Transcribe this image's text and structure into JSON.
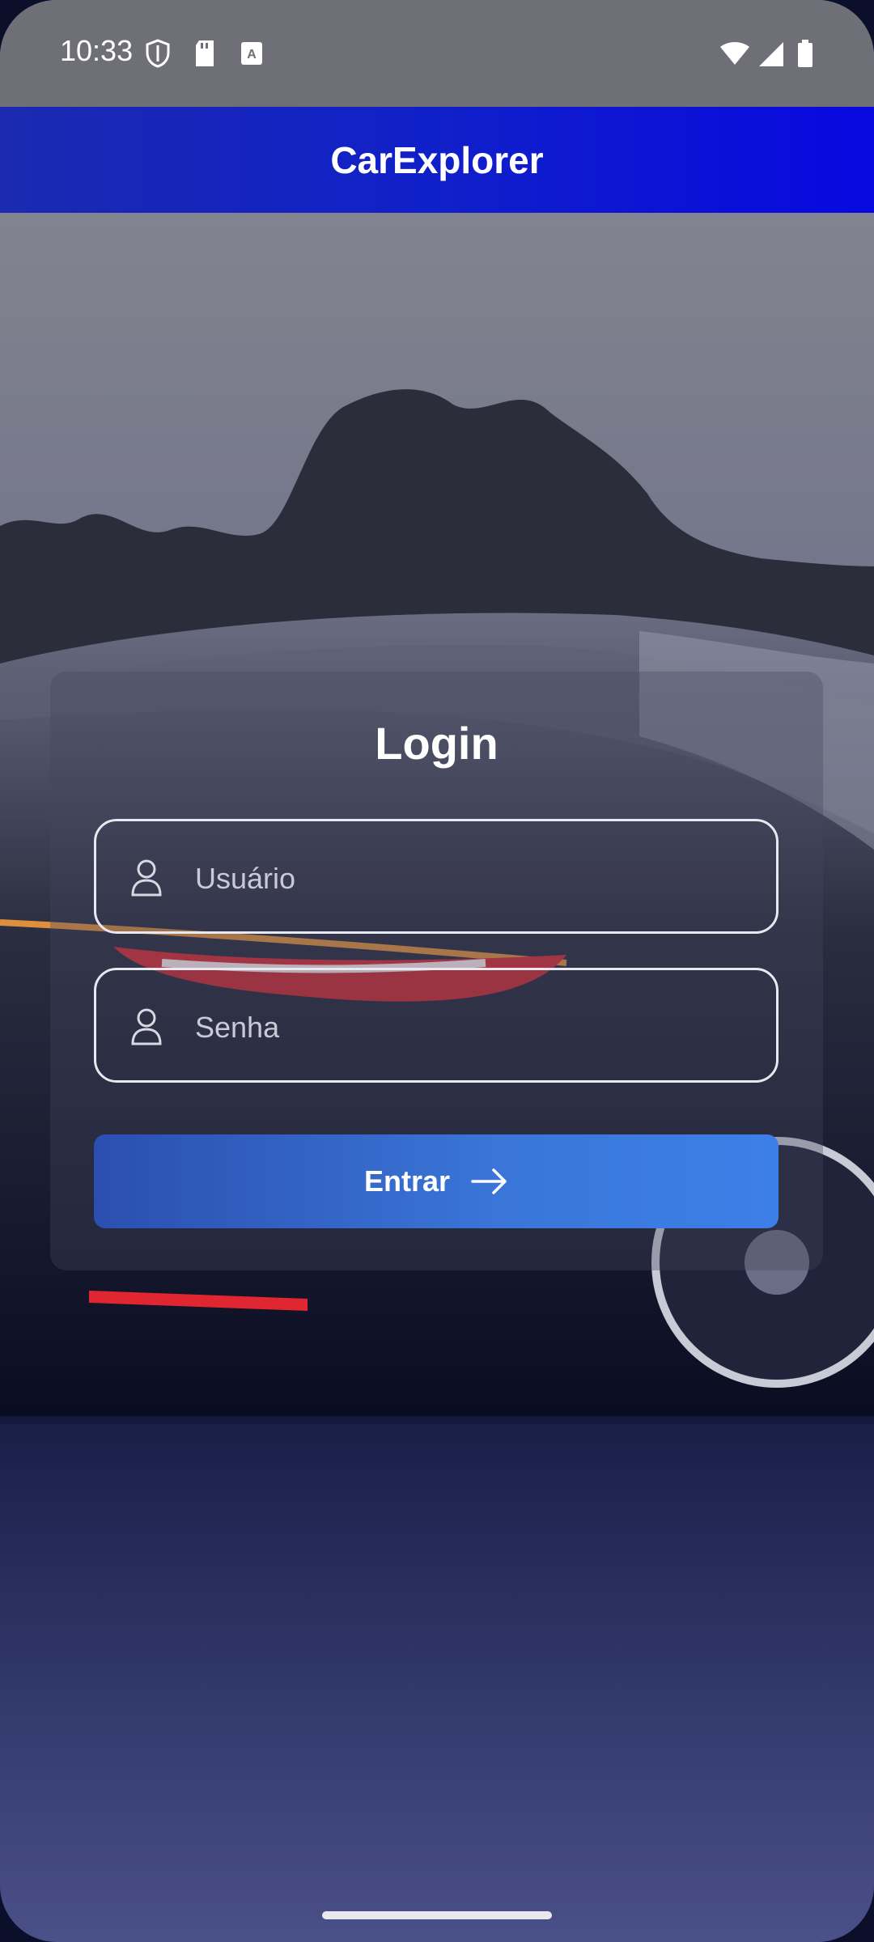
{
  "status_bar": {
    "time": "10:33",
    "icons": [
      "shield-icon",
      "sd-card-icon",
      "text-icon",
      "wifi-icon",
      "signal-icon",
      "battery-icon"
    ]
  },
  "app_bar": {
    "title": "CarExplorer",
    "color_start": "#1b2ab0",
    "color_end": "#0808e0"
  },
  "login": {
    "title": "Login",
    "username": {
      "placeholder": "Usuário",
      "value": "",
      "icon": "user-icon"
    },
    "password": {
      "placeholder": "Senha",
      "value": "",
      "icon": "user-icon"
    },
    "submit_label": "Entrar",
    "submit_icon": "arrow-right-icon",
    "accent": "#3a76d8"
  }
}
